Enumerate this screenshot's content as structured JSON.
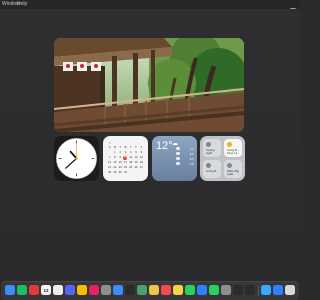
{
  "menubar": {
    "items": [
      {
        "label": "Window"
      },
      {
        "label": "Help"
      }
    ]
  },
  "colors": {
    "desktop": "#2b2b2c",
    "menubar": "#262627",
    "calendar_accent": "#e53935",
    "weather_top": "#8ea5c4",
    "weather_bottom": "#687f9d"
  },
  "photo_widget": {
    "subject": "wooden shrine veranda with green maple trees"
  },
  "clock_widget": {
    "time_hour": 10,
    "time_minute": 38,
    "time_second": 0
  },
  "calendar_widget": {
    "weekday_headers": [
      "S",
      "M",
      "T",
      "W",
      "T",
      "F",
      "S"
    ],
    "weeks": [
      [
        "",
        "1",
        "2",
        "3",
        "4",
        "5",
        "6"
      ],
      [
        "7",
        "8",
        "9",
        "10",
        "11",
        "12",
        "13"
      ],
      [
        "14",
        "15",
        "16",
        "17",
        "18",
        "19",
        "20"
      ],
      [
        "21",
        "22",
        "23",
        "24",
        "25",
        "26",
        "27"
      ],
      [
        "28",
        "29",
        "30",
        "31",
        "",
        "",
        ""
      ]
    ],
    "today": "10"
  },
  "weather_widget": {
    "temperature": "12°",
    "forecast": [
      {
        "temp": "11°"
      },
      {
        "temp": "12°"
      },
      {
        "temp": "12°"
      },
      {
        "temp": "14°"
      }
    ]
  },
  "home_widget": {
    "tiles": [
      {
        "label": "Ceiling Light"
      },
      {
        "label": "Living R... Floor La..."
      },
      {
        "label": "Living R..."
      },
      {
        "label": "Office Big Light"
      }
    ]
  },
  "dock": {
    "calendar_date": "12",
    "apps": [
      {
        "name": "finder",
        "color": "#3d8bfd"
      },
      {
        "name": "music",
        "color": "#1dbd63"
      },
      {
        "name": "youtube",
        "color": "#e53935"
      },
      {
        "name": "calendar",
        "color": "#f4f4f4"
      },
      {
        "name": "tasks",
        "color": "#ededed"
      },
      {
        "name": "messenger",
        "color": "#5865f2"
      },
      {
        "name": "photos",
        "color": "#fbbc04"
      },
      {
        "name": "news",
        "color": "#e91e63"
      },
      {
        "name": "launchpad",
        "color": "#8f8f8f"
      },
      {
        "name": "mail",
        "color": "#3d8bfd"
      },
      {
        "name": "stage",
        "color": "#2b2b2b"
      },
      {
        "name": "maps",
        "color": "#4aa36e"
      },
      {
        "name": "preview",
        "color": "#f0c34a"
      },
      {
        "name": "music-player",
        "color": "#f34b55"
      },
      {
        "name": "notes",
        "color": "#f3d34a"
      },
      {
        "name": "facetime",
        "color": "#2bd15c"
      },
      {
        "name": "appstore",
        "color": "#2f80ff"
      },
      {
        "name": "whatsapp",
        "color": "#2bd15c"
      },
      {
        "name": "settings",
        "color": "#8f8f8f"
      },
      {
        "name": "clock",
        "color": "#2b2b2b"
      },
      {
        "name": "activity",
        "color": "#2b2b2b"
      },
      {
        "name": "folder",
        "color": "#39a8ff"
      },
      {
        "name": "downloads",
        "color": "#2f80ff"
      },
      {
        "name": "trash",
        "color": "#d8d8d8"
      }
    ]
  }
}
